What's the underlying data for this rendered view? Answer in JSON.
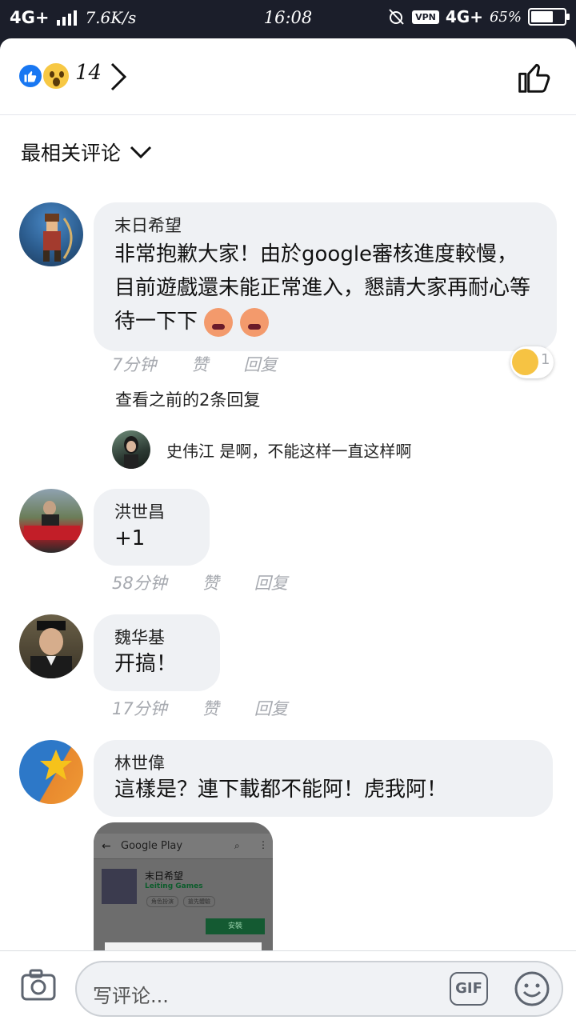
{
  "status_bar": {
    "network": "4G+",
    "speed": "7.6K/s",
    "time": "16:08",
    "vpn": "VPN",
    "network_right": "4G+",
    "battery": "65%"
  },
  "reactions": {
    "count": "14"
  },
  "sort": {
    "label": "最相关评论"
  },
  "comments": [
    {
      "author": "末日希望",
      "text": "非常抱歉大家！由於google審核進度較慢，目前遊戲還未能正常進入，懇請大家再耐心等待一下下",
      "time": "7分钟",
      "like": "赞",
      "reply": "回复",
      "reaction_count": "1",
      "view_previous": "查看之前的2条回复",
      "latest_reply": {
        "author": "史伟江",
        "text": "是啊，不能这样一直这样啊"
      }
    },
    {
      "author": "洪世昌",
      "text": "+1",
      "time": "58分钟",
      "like": "赞",
      "reply": "回复"
    },
    {
      "author": "魏华基",
      "text": "开搞！",
      "time": "17分钟",
      "like": "赞",
      "reply": "回复"
    },
    {
      "author": "林世偉",
      "text": "這樣是？連下載都不能阿！虎我阿！",
      "attachment": {
        "store_title": "Google Play",
        "app_name": "末日希望",
        "developer": "Leiting Games",
        "tag1": "角色扮演",
        "tag2": "搶先體驗",
        "install": "安裝"
      }
    }
  ],
  "composer": {
    "placeholder": "写评论...",
    "gif": "GIF"
  },
  "colors": {
    "bubble": "#eff1f4",
    "meta": "#a6a9af",
    "facebook_blue": "#1877f2"
  }
}
